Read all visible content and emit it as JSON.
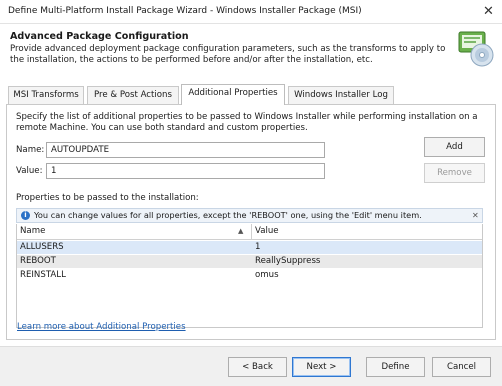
{
  "window": {
    "title": "Define Multi-Platform Install Package Wizard - Windows Installer Package (MSI)",
    "close_glyph": "✕"
  },
  "header": {
    "title": "Advanced Package Configuration",
    "description": "Provide advanced deployment package configuration parameters, such as the transforms to apply to the installation, the actions to be performed before and/or after the installation, etc."
  },
  "tabs": [
    {
      "label": "MSI Transforms",
      "active": false
    },
    {
      "label": "Pre & Post Actions",
      "active": false
    },
    {
      "label": "Additional Properties",
      "active": true
    },
    {
      "label": "Windows Installer Log",
      "active": false
    }
  ],
  "additional_properties": {
    "intro": "Specify the list of additional properties to be passed to Windows Installer while performing installation on a remote Machine. You can use both standard and custom properties.",
    "name_label": "Name:",
    "name_value": "AUTOUPDATE",
    "value_label": "Value:",
    "value_value": "1",
    "add_label": "Add",
    "remove_label": "Remove",
    "list_label": "Properties to be passed to the installation:",
    "info_text": "You can change values for all properties, except the 'REBOOT' one, using the 'Edit' menu item.",
    "columns": {
      "name": "Name",
      "value": "Value"
    },
    "sort_glyph": "▲",
    "rows": [
      {
        "name": "ALLUSERS",
        "value": "1",
        "selected": true
      },
      {
        "name": "REBOOT",
        "value": "ReallySuppress",
        "selected": false,
        "disabled": true
      },
      {
        "name": "REINSTALL",
        "value": "omus",
        "selected": false
      }
    ],
    "learn_more": "Learn more about Additional Properties"
  },
  "footer": {
    "back": "< Back",
    "next": "Next >",
    "define": "Define",
    "cancel": "Cancel"
  },
  "colors": {
    "accent": "#2f77d1",
    "selected_row": "#dbe8f8",
    "disabled_row": "#e9e9e9",
    "link": "#1f5fb0"
  }
}
